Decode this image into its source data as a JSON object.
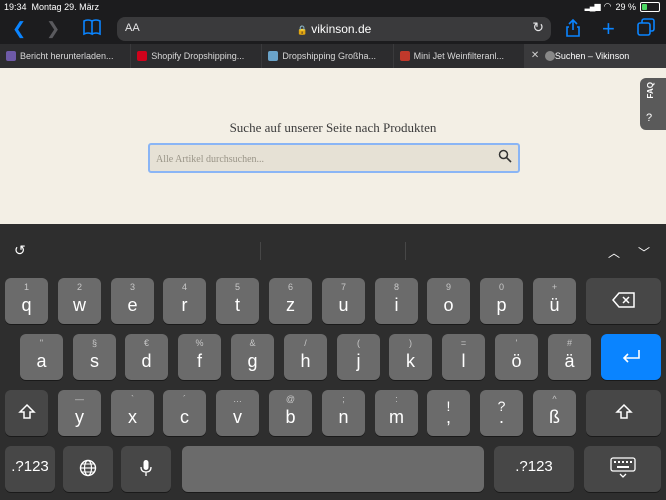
{
  "status_bar": {
    "time": "19:34",
    "date": "Montag 29. März",
    "battery": "29 %"
  },
  "toolbar": {
    "aa": "AA",
    "url": "vikinson.de"
  },
  "tabs": [
    {
      "title": "Bericht herunterladen...",
      "icon_color": "#6e5aa8"
    },
    {
      "title": "Shopify Dropshipping...",
      "icon_color": "#d0021b"
    },
    {
      "title": "Dropshipping Großha...",
      "icon_color": "#6aa3c9"
    },
    {
      "title": "Mini Jet Weinfilteranl...",
      "icon_color": "#c0392b"
    },
    {
      "title": "Suchen – Vikinson",
      "icon_color": "#888888"
    }
  ],
  "page": {
    "headline": "Suche auf unserer Seite nach Produkten",
    "search_placeholder": "Alle Artikel durchsuchen...",
    "faq_label": "FAQ"
  },
  "keyboard": {
    "row1": [
      {
        "h": "1",
        "m": "q"
      },
      {
        "h": "2",
        "m": "w"
      },
      {
        "h": "3",
        "m": "e"
      },
      {
        "h": "4",
        "m": "r"
      },
      {
        "h": "5",
        "m": "t"
      },
      {
        "h": "6",
        "m": "z"
      },
      {
        "h": "7",
        "m": "u"
      },
      {
        "h": "8",
        "m": "i"
      },
      {
        "h": "9",
        "m": "o"
      },
      {
        "h": "0",
        "m": "p"
      },
      {
        "h": "+",
        "m": "ü"
      }
    ],
    "row2": [
      {
        "h": "\"",
        "m": "a"
      },
      {
        "h": "§",
        "m": "s"
      },
      {
        "h": "€",
        "m": "d"
      },
      {
        "h": "%",
        "m": "f"
      },
      {
        "h": "&",
        "m": "g"
      },
      {
        "h": "/",
        "m": "h"
      },
      {
        "h": "(",
        "m": "j"
      },
      {
        "h": ")",
        "m": "k"
      },
      {
        "h": "=",
        "m": "l"
      },
      {
        "h": "'",
        "m": "ö"
      },
      {
        "h": "#",
        "m": "ä"
      }
    ],
    "row3": [
      {
        "h": "—",
        "m": "y"
      },
      {
        "h": "`",
        "m": "x"
      },
      {
        "h": "´",
        "m": "c"
      },
      {
        "h": "…",
        "m": "v"
      },
      {
        "h": "@",
        "m": "b"
      },
      {
        "h": ";",
        "m": "n"
      },
      {
        "h": ":",
        "m": "m"
      },
      {
        "h": "!",
        "m": ","
      },
      {
        "h": "?",
        "m": "."
      },
      {
        "h": "^",
        "m": "ß"
      }
    ],
    "num_label": ".?123"
  }
}
